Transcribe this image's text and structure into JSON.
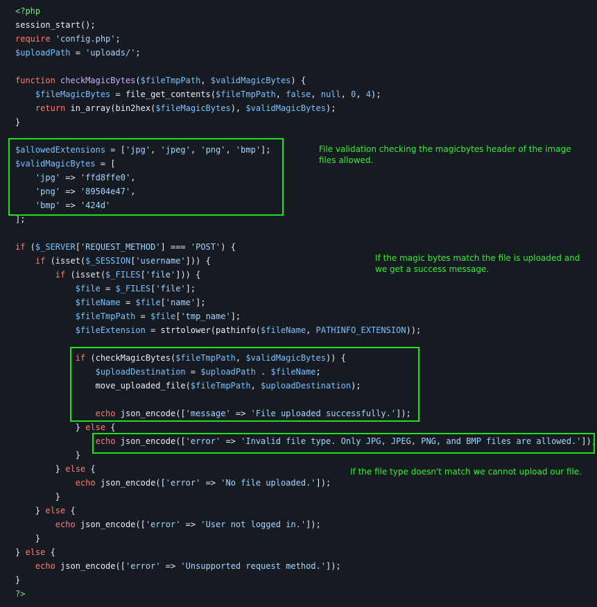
{
  "code_lines": [
    [
      {
        "t": "<?php",
        "c": "tag"
      }
    ],
    [
      {
        "t": "session_start();",
        "c": "p"
      }
    ],
    [
      {
        "t": "require",
        "c": "kw"
      },
      {
        "t": " ",
        "c": "p"
      },
      {
        "t": "'config.php'",
        "c": "str"
      },
      {
        "t": ";",
        "c": "p"
      }
    ],
    [
      {
        "t": "$uploadPath",
        "c": "var"
      },
      {
        "t": " = ",
        "c": "p"
      },
      {
        "t": "'uploads/'",
        "c": "str"
      },
      {
        "t": ";",
        "c": "p"
      }
    ],
    [],
    [
      {
        "t": "function",
        "c": "kw"
      },
      {
        "t": " ",
        "c": "p"
      },
      {
        "t": "checkMagicBytes",
        "c": "fn"
      },
      {
        "t": "(",
        "c": "p"
      },
      {
        "t": "$fileTmpPath",
        "c": "var"
      },
      {
        "t": ", ",
        "c": "p"
      },
      {
        "t": "$validMagicBytes",
        "c": "var"
      },
      {
        "t": ") {",
        "c": "p"
      }
    ],
    [
      {
        "t": "    ",
        "c": "p"
      },
      {
        "t": "$fileMagicBytes",
        "c": "var"
      },
      {
        "t": " = file_get_contents(",
        "c": "p"
      },
      {
        "t": "$fileTmpPath",
        "c": "var"
      },
      {
        "t": ", ",
        "c": "p"
      },
      {
        "t": "false",
        "c": "var"
      },
      {
        "t": ", ",
        "c": "p"
      },
      {
        "t": "null",
        "c": "var"
      },
      {
        "t": ", ",
        "c": "p"
      },
      {
        "t": "0",
        "c": "var"
      },
      {
        "t": ", ",
        "c": "p"
      },
      {
        "t": "4",
        "c": "var"
      },
      {
        "t": ");",
        "c": "p"
      }
    ],
    [
      {
        "t": "    ",
        "c": "p"
      },
      {
        "t": "return",
        "c": "kw"
      },
      {
        "t": " in_array(bin2hex(",
        "c": "p"
      },
      {
        "t": "$fileMagicBytes",
        "c": "var"
      },
      {
        "t": "), ",
        "c": "p"
      },
      {
        "t": "$validMagicBytes",
        "c": "var"
      },
      {
        "t": ");",
        "c": "p"
      }
    ],
    [
      {
        "t": "}",
        "c": "p"
      }
    ],
    [],
    [
      {
        "t": "$allowedExtensions",
        "c": "var"
      },
      {
        "t": " = [",
        "c": "p"
      },
      {
        "t": "'jpg'",
        "c": "str"
      },
      {
        "t": ", ",
        "c": "p"
      },
      {
        "t": "'jpeg'",
        "c": "str"
      },
      {
        "t": ", ",
        "c": "p"
      },
      {
        "t": "'png'",
        "c": "str"
      },
      {
        "t": ", ",
        "c": "p"
      },
      {
        "t": "'bmp'",
        "c": "str"
      },
      {
        "t": "];",
        "c": "p"
      }
    ],
    [
      {
        "t": "$validMagicBytes",
        "c": "var"
      },
      {
        "t": " = [",
        "c": "p"
      }
    ],
    [
      {
        "t": "    ",
        "c": "p"
      },
      {
        "t": "'jpg'",
        "c": "str"
      },
      {
        "t": " => ",
        "c": "p"
      },
      {
        "t": "'ffd8ffe0'",
        "c": "str"
      },
      {
        "t": ",",
        "c": "p"
      }
    ],
    [
      {
        "t": "    ",
        "c": "p"
      },
      {
        "t": "'png'",
        "c": "str"
      },
      {
        "t": " => ",
        "c": "p"
      },
      {
        "t": "'89504e47'",
        "c": "str"
      },
      {
        "t": ",",
        "c": "p"
      }
    ],
    [
      {
        "t": "    ",
        "c": "p"
      },
      {
        "t": "'bmp'",
        "c": "str"
      },
      {
        "t": " => ",
        "c": "p"
      },
      {
        "t": "'424d'",
        "c": "str"
      }
    ],
    [
      {
        "t": "];",
        "c": "p"
      }
    ],
    [],
    [
      {
        "t": "if",
        "c": "kw"
      },
      {
        "t": " (",
        "c": "p"
      },
      {
        "t": "$_SERVER",
        "c": "var"
      },
      {
        "t": "[",
        "c": "p"
      },
      {
        "t": "'REQUEST_METHOD'",
        "c": "str"
      },
      {
        "t": "] === ",
        "c": "p"
      },
      {
        "t": "'POST'",
        "c": "str"
      },
      {
        "t": ") {",
        "c": "p"
      }
    ],
    [
      {
        "t": "    ",
        "c": "p"
      },
      {
        "t": "if",
        "c": "kw"
      },
      {
        "t": " (isset(",
        "c": "p"
      },
      {
        "t": "$_SESSION",
        "c": "var"
      },
      {
        "t": "[",
        "c": "p"
      },
      {
        "t": "'username'",
        "c": "str"
      },
      {
        "t": "])) {",
        "c": "p"
      }
    ],
    [
      {
        "t": "        ",
        "c": "p"
      },
      {
        "t": "if",
        "c": "kw"
      },
      {
        "t": " (isset(",
        "c": "p"
      },
      {
        "t": "$_FILES",
        "c": "var"
      },
      {
        "t": "[",
        "c": "p"
      },
      {
        "t": "'file'",
        "c": "str"
      },
      {
        "t": "])) {",
        "c": "p"
      }
    ],
    [
      {
        "t": "            ",
        "c": "p"
      },
      {
        "t": "$file",
        "c": "var"
      },
      {
        "t": " = ",
        "c": "p"
      },
      {
        "t": "$_FILES",
        "c": "var"
      },
      {
        "t": "[",
        "c": "p"
      },
      {
        "t": "'file'",
        "c": "str"
      },
      {
        "t": "];",
        "c": "p"
      }
    ],
    [
      {
        "t": "            ",
        "c": "p"
      },
      {
        "t": "$fileName",
        "c": "var"
      },
      {
        "t": " = ",
        "c": "p"
      },
      {
        "t": "$file",
        "c": "var"
      },
      {
        "t": "[",
        "c": "p"
      },
      {
        "t": "'name'",
        "c": "str"
      },
      {
        "t": "];",
        "c": "p"
      }
    ],
    [
      {
        "t": "            ",
        "c": "p"
      },
      {
        "t": "$fileTmpPath",
        "c": "var"
      },
      {
        "t": " = ",
        "c": "p"
      },
      {
        "t": "$file",
        "c": "var"
      },
      {
        "t": "[",
        "c": "p"
      },
      {
        "t": "'tmp_name'",
        "c": "str"
      },
      {
        "t": "];",
        "c": "p"
      }
    ],
    [
      {
        "t": "            ",
        "c": "p"
      },
      {
        "t": "$fileExtension",
        "c": "var"
      },
      {
        "t": " = strtolower(pathinfo(",
        "c": "p"
      },
      {
        "t": "$fileName",
        "c": "var"
      },
      {
        "t": ", ",
        "c": "p"
      },
      {
        "t": "PATHINFO_EXTENSION",
        "c": "var"
      },
      {
        "t": "));",
        "c": "p"
      }
    ],
    [],
    [
      {
        "t": "            ",
        "c": "p"
      },
      {
        "t": "if",
        "c": "kw"
      },
      {
        "t": " (checkMagicBytes(",
        "c": "p"
      },
      {
        "t": "$fileTmpPath",
        "c": "var"
      },
      {
        "t": ", ",
        "c": "p"
      },
      {
        "t": "$validMagicBytes",
        "c": "var"
      },
      {
        "t": ")) {",
        "c": "p"
      }
    ],
    [
      {
        "t": "                ",
        "c": "p"
      },
      {
        "t": "$uploadDestination",
        "c": "var"
      },
      {
        "t": " = ",
        "c": "p"
      },
      {
        "t": "$uploadPath",
        "c": "var"
      },
      {
        "t": " . ",
        "c": "p"
      },
      {
        "t": "$fileName",
        "c": "var"
      },
      {
        "t": ";",
        "c": "p"
      }
    ],
    [
      {
        "t": "                move_uploaded_file(",
        "c": "p"
      },
      {
        "t": "$fileTmpPath",
        "c": "var"
      },
      {
        "t": ", ",
        "c": "p"
      },
      {
        "t": "$uploadDestination",
        "c": "var"
      },
      {
        "t": ");",
        "c": "p"
      }
    ],
    [],
    [
      {
        "t": "                ",
        "c": "p"
      },
      {
        "t": "echo",
        "c": "kw"
      },
      {
        "t": " json_encode([",
        "c": "p"
      },
      {
        "t": "'message'",
        "c": "str"
      },
      {
        "t": " => ",
        "c": "p"
      },
      {
        "t": "'File uploaded successfully.'",
        "c": "str"
      },
      {
        "t": "]);",
        "c": "p"
      }
    ],
    [
      {
        "t": "            } ",
        "c": "p"
      },
      {
        "t": "else",
        "c": "kw"
      },
      {
        "t": " {",
        "c": "p"
      }
    ],
    [
      {
        "t": "                ",
        "c": "p"
      },
      {
        "t": "echo",
        "c": "kw"
      },
      {
        "t": " json_encode([",
        "c": "p"
      },
      {
        "t": "'error'",
        "c": "str"
      },
      {
        "t": " => ",
        "c": "p"
      },
      {
        "t": "'Invalid file type. Only JPG, JPEG, PNG, and BMP files are allowed.'",
        "c": "str"
      },
      {
        "t": "]);",
        "c": "p"
      }
    ],
    [
      {
        "t": "            }",
        "c": "p"
      }
    ],
    [
      {
        "t": "        } ",
        "c": "p"
      },
      {
        "t": "else",
        "c": "kw"
      },
      {
        "t": " {",
        "c": "p"
      }
    ],
    [
      {
        "t": "            ",
        "c": "p"
      },
      {
        "t": "echo",
        "c": "kw"
      },
      {
        "t": " json_encode([",
        "c": "p"
      },
      {
        "t": "'error'",
        "c": "str"
      },
      {
        "t": " => ",
        "c": "p"
      },
      {
        "t": "'No file uploaded.'",
        "c": "str"
      },
      {
        "t": "]);",
        "c": "p"
      }
    ],
    [
      {
        "t": "        }",
        "c": "p"
      }
    ],
    [
      {
        "t": "    } ",
        "c": "p"
      },
      {
        "t": "else",
        "c": "kw"
      },
      {
        "t": " {",
        "c": "p"
      }
    ],
    [
      {
        "t": "        ",
        "c": "p"
      },
      {
        "t": "echo",
        "c": "kw"
      },
      {
        "t": " json_encode([",
        "c": "p"
      },
      {
        "t": "'error'",
        "c": "str"
      },
      {
        "t": " => ",
        "c": "p"
      },
      {
        "t": "'User not logged in.'",
        "c": "str"
      },
      {
        "t": "]);",
        "c": "p"
      }
    ],
    [
      {
        "t": "    }",
        "c": "p"
      }
    ],
    [
      {
        "t": "} ",
        "c": "p"
      },
      {
        "t": "else",
        "c": "kw"
      },
      {
        "t": " {",
        "c": "p"
      }
    ],
    [
      {
        "t": "    ",
        "c": "p"
      },
      {
        "t": "echo",
        "c": "kw"
      },
      {
        "t": " json_encode([",
        "c": "p"
      },
      {
        "t": "'error'",
        "c": "str"
      },
      {
        "t": " => ",
        "c": "p"
      },
      {
        "t": "'Unsupported request method.'",
        "c": "str"
      },
      {
        "t": "]);",
        "c": "p"
      }
    ],
    [
      {
        "t": "}",
        "c": "p"
      }
    ],
    [
      {
        "t": "?>",
        "c": "tag"
      }
    ]
  ],
  "annotations": {
    "validation_note": "File validation checking the magicbytes header of the image files allowed.",
    "success_note": "If the magic bytes match the file is uploaded and we get a success message.",
    "failure_note": "If the file type doesn't match we cannot upload our file."
  },
  "colors": {
    "background": "#161b22",
    "highlight": "#22dd22",
    "annotation_text": "#33ee33"
  }
}
